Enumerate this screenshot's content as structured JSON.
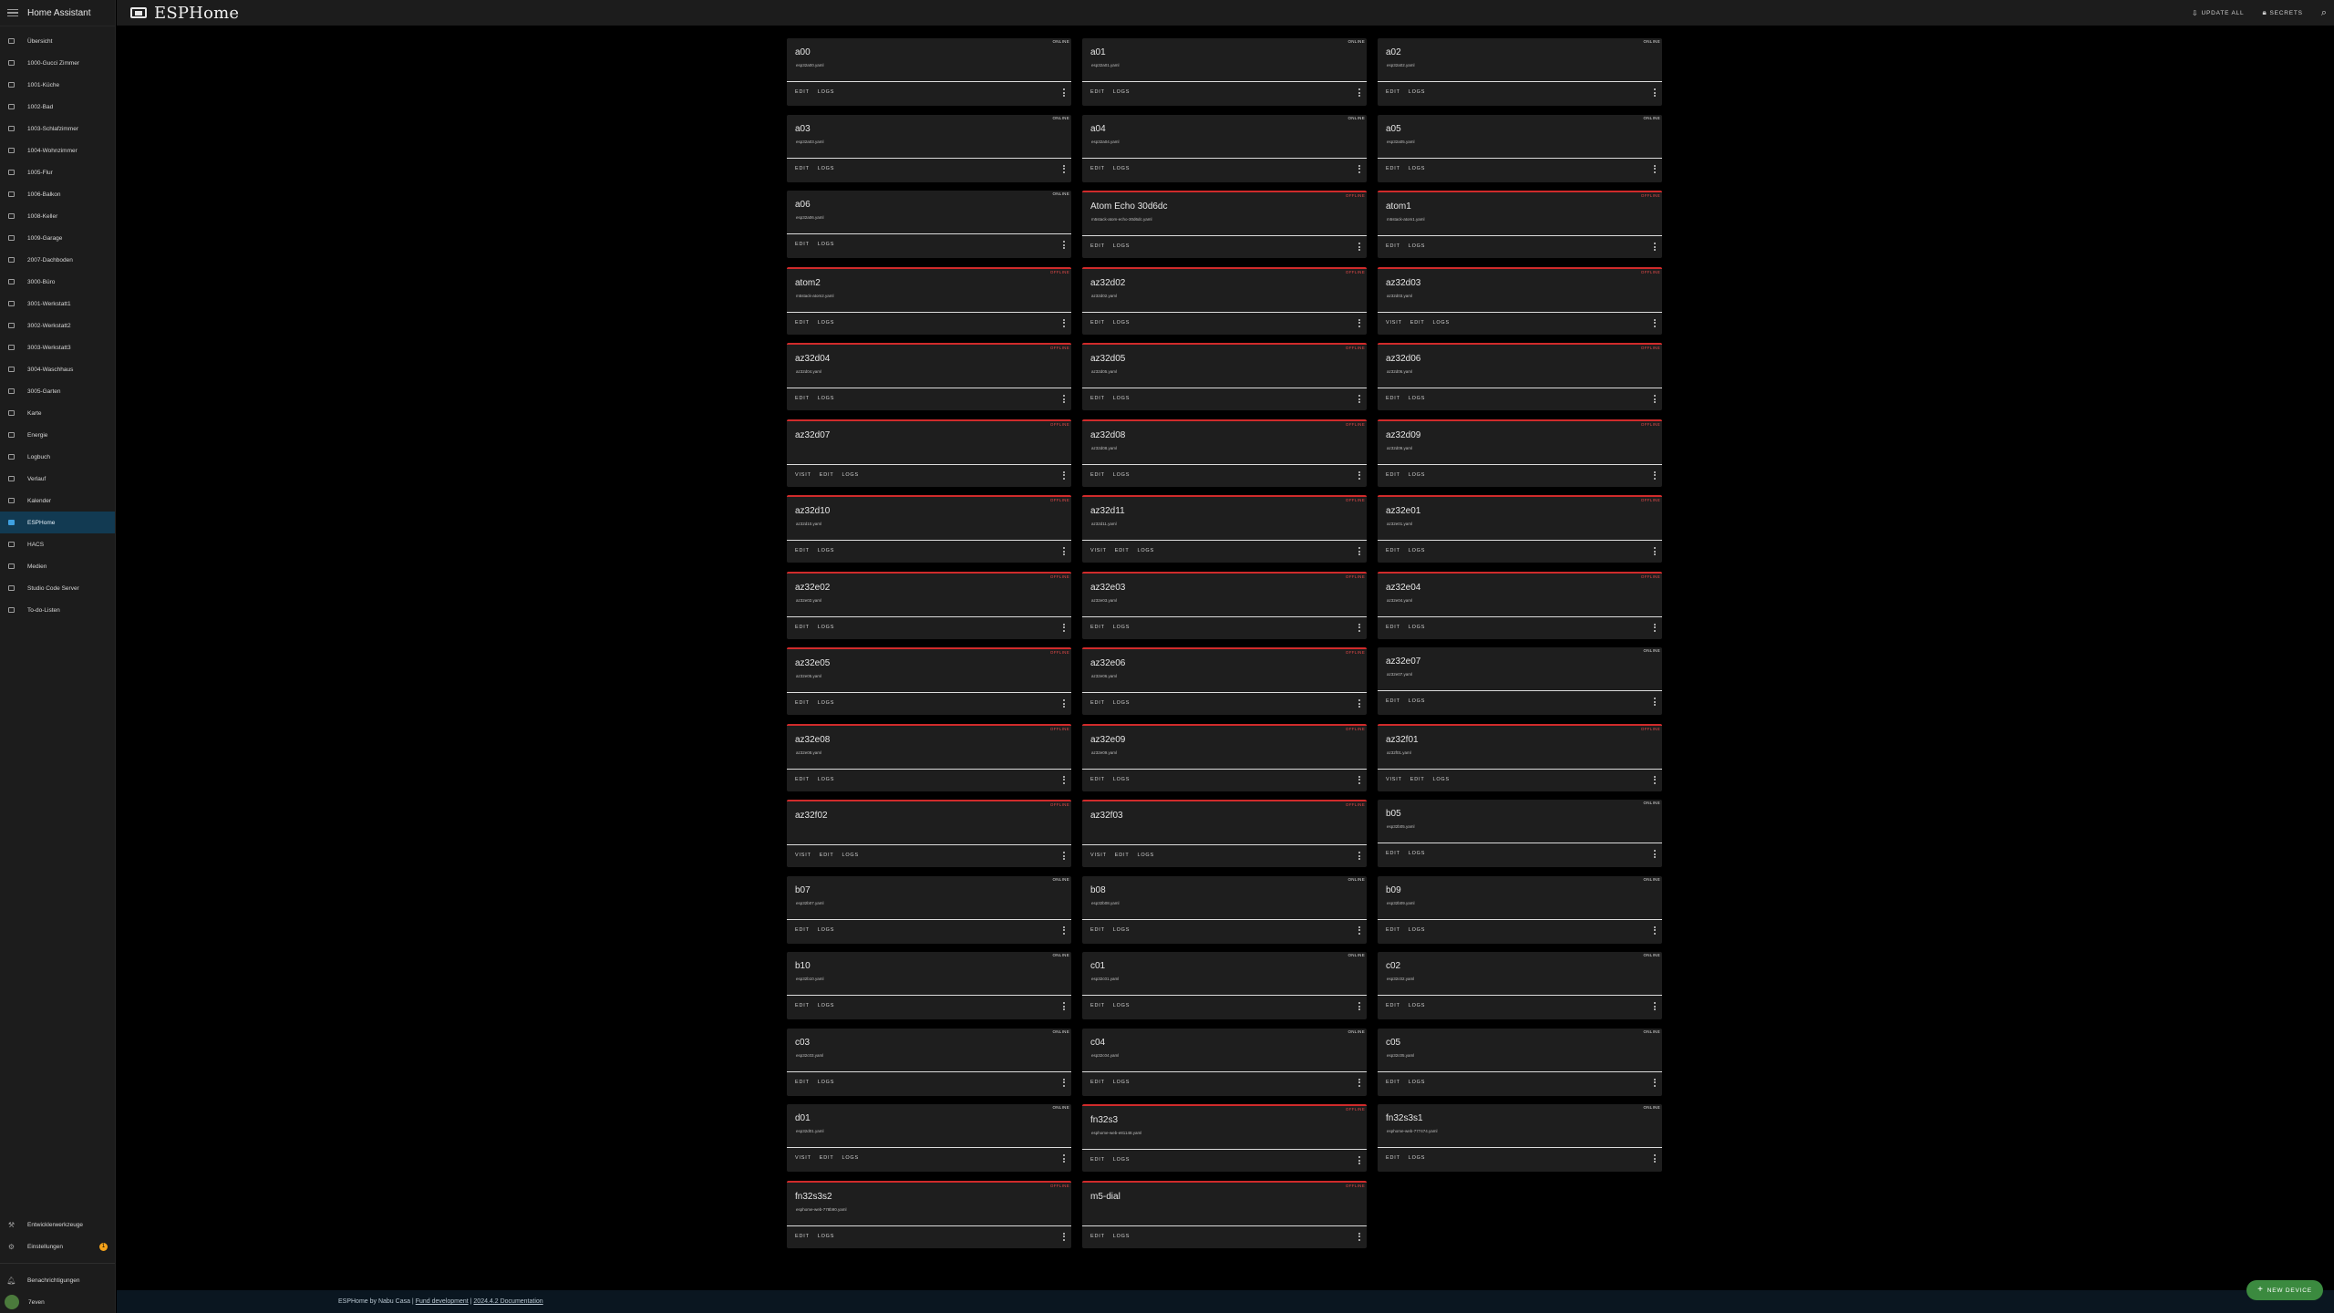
{
  "sidebar": {
    "title": "Home Assistant",
    "items": [
      {
        "label": "Übersicht",
        "icon": "dashboard-icon"
      },
      {
        "label": "1000-Gucci Zimmer",
        "icon": "sofa-icon"
      },
      {
        "label": "1001-Küche",
        "icon": "stove-icon"
      },
      {
        "label": "1002-Bad",
        "icon": "bath-icon"
      },
      {
        "label": "1003-Schlafzimmer",
        "icon": "bed-icon"
      },
      {
        "label": "1004-Wohnzimmer",
        "icon": "tv-icon"
      },
      {
        "label": "1005-Flur",
        "icon": "door-icon"
      },
      {
        "label": "1006-Balkon",
        "icon": "flower-icon"
      },
      {
        "label": "1008-Keller",
        "icon": "stairs-icon"
      },
      {
        "label": "1009-Garage",
        "icon": "garage-icon"
      },
      {
        "label": "2007-Dachboden",
        "icon": "monitor-icon"
      },
      {
        "label": "3000-Büro",
        "icon": "desk-icon"
      },
      {
        "label": "3001-Werkstatt1",
        "icon": "tools-icon"
      },
      {
        "label": "3002-Werkstatt2",
        "icon": "wrench-icon"
      },
      {
        "label": "3003-Werkstatt3",
        "icon": "hammer-icon"
      },
      {
        "label": "3004-Waschhaus",
        "icon": "washer-icon"
      },
      {
        "label": "3005-Garten",
        "icon": "tree-icon"
      },
      {
        "label": "Karte",
        "icon": "map-icon"
      },
      {
        "label": "Energie",
        "icon": "lightning-icon"
      },
      {
        "label": "Logbuch",
        "icon": "list-icon"
      },
      {
        "label": "Verlauf",
        "icon": "chart-icon"
      },
      {
        "label": "Kalender",
        "icon": "calendar-icon"
      },
      {
        "label": "ESPHome",
        "icon": "esphome-icon",
        "active": true
      },
      {
        "label": "HACS",
        "icon": "hacs-icon"
      },
      {
        "label": "Medien",
        "icon": "media-icon"
      },
      {
        "label": "Studio Code Server",
        "icon": "code-icon"
      },
      {
        "label": "To-do-Listen",
        "icon": "checklist-icon"
      }
    ],
    "bottom": {
      "dev_tools": "Entwicklerwerkzeuge",
      "settings": "Einstellungen",
      "settings_badge": "1",
      "notifications": "Benachrichtigungen",
      "user": "7even"
    }
  },
  "topbar": {
    "title": "ESPHome",
    "update_all": "UPDATE ALL",
    "secrets": "SECRETS",
    "search_icon": "search-icon"
  },
  "labels": {
    "online": "ONLINE",
    "offline": "OFFLINE",
    "edit": "EDIT",
    "logs": "LOGS",
    "visit": "VISIT"
  },
  "devices": [
    {
      "name": "a00",
      "file": "esp32a00.yaml",
      "online": true,
      "visit": false
    },
    {
      "name": "a01",
      "file": "esp32a01.yaml",
      "online": true,
      "visit": false
    },
    {
      "name": "a02",
      "file": "esp32a02.yaml",
      "online": true,
      "visit": false
    },
    {
      "name": "a03",
      "file": "esp32a03.yaml",
      "online": true,
      "visit": false
    },
    {
      "name": "a04",
      "file": "esp32a04.yaml",
      "online": true,
      "visit": false
    },
    {
      "name": "a05",
      "file": "esp32a05.yaml",
      "online": true,
      "visit": false
    },
    {
      "name": "a06",
      "file": "esp32a06.yaml",
      "online": true,
      "visit": false
    },
    {
      "name": "Atom Echo 30d6dc",
      "file": "m5stack-atom-echo-30d6dc.yaml",
      "online": false,
      "visit": false
    },
    {
      "name": "atom1",
      "file": "m5stack-atom1.yaml",
      "online": false,
      "visit": false
    },
    {
      "name": "atom2",
      "file": "m5stack-atom2.yaml",
      "online": false,
      "visit": false
    },
    {
      "name": "az32d02",
      "file": "az32d02.yaml",
      "online": false,
      "visit": false
    },
    {
      "name": "az32d03",
      "file": "az32d03.yaml",
      "online": false,
      "visit": true
    },
    {
      "name": "az32d04",
      "file": "az32d04.yaml",
      "online": false,
      "visit": false
    },
    {
      "name": "az32d05",
      "file": "az32d05.yaml",
      "online": false,
      "visit": false
    },
    {
      "name": "az32d06",
      "file": "az32d06.yaml",
      "online": false,
      "visit": false
    },
    {
      "name": "az32d07",
      "file": "",
      "online": false,
      "visit": true
    },
    {
      "name": "az32d08",
      "file": "az32d08.yaml",
      "online": false,
      "visit": false
    },
    {
      "name": "az32d09",
      "file": "az32d09.yaml",
      "online": false,
      "visit": false
    },
    {
      "name": "az32d10",
      "file": "az32d10.yaml",
      "online": false,
      "visit": false
    },
    {
      "name": "az32d11",
      "file": "az32d11.yaml",
      "online": false,
      "visit": true
    },
    {
      "name": "az32e01",
      "file": "az32e01.yaml",
      "online": false,
      "visit": false
    },
    {
      "name": "az32e02",
      "file": "az32e02.yaml",
      "online": false,
      "visit": false
    },
    {
      "name": "az32e03",
      "file": "az32e03.yaml",
      "online": false,
      "visit": false
    },
    {
      "name": "az32e04",
      "file": "az32e04.yaml",
      "online": false,
      "visit": false
    },
    {
      "name": "az32e05",
      "file": "az32e05.yaml",
      "online": false,
      "visit": false
    },
    {
      "name": "az32e06",
      "file": "az32e06.yaml",
      "online": false,
      "visit": false
    },
    {
      "name": "az32e07",
      "file": "az32e07.yaml",
      "online": true,
      "visit": false
    },
    {
      "name": "az32e08",
      "file": "az32e08.yaml",
      "online": false,
      "visit": false
    },
    {
      "name": "az32e09",
      "file": "az32e09.yaml",
      "online": false,
      "visit": false
    },
    {
      "name": "az32f01",
      "file": "az32f01.yaml",
      "online": false,
      "visit": true
    },
    {
      "name": "az32f02",
      "file": "",
      "online": false,
      "visit": true
    },
    {
      "name": "az32f03",
      "file": "",
      "online": false,
      "visit": true
    },
    {
      "name": "b05",
      "file": "esp32b05.yaml",
      "online": true,
      "visit": false
    },
    {
      "name": "b07",
      "file": "esp32b07.yaml",
      "online": true,
      "visit": false
    },
    {
      "name": "b08",
      "file": "esp32b08.yaml",
      "online": true,
      "visit": false
    },
    {
      "name": "b09",
      "file": "esp32b09.yaml",
      "online": true,
      "visit": false
    },
    {
      "name": "b10",
      "file": "esp32b10.yaml",
      "online": true,
      "visit": false
    },
    {
      "name": "c01",
      "file": "esp32c01.yaml",
      "online": true,
      "visit": false
    },
    {
      "name": "c02",
      "file": "esp32c02.yaml",
      "online": true,
      "visit": false
    },
    {
      "name": "c03",
      "file": "esp32c03.yaml",
      "online": true,
      "visit": false
    },
    {
      "name": "c04",
      "file": "esp32c04.yaml",
      "online": true,
      "visit": false
    },
    {
      "name": "c05",
      "file": "esp32c05.yaml",
      "online": true,
      "visit": false
    },
    {
      "name": "d01",
      "file": "esp32d01.yaml",
      "online": true,
      "visit": true
    },
    {
      "name": "fn32s3",
      "file": "esphome-web-e81148.yaml",
      "online": false,
      "visit": false
    },
    {
      "name": "fn32s3s1",
      "file": "esphome-web-777474.yaml",
      "online": true,
      "visit": false
    },
    {
      "name": "fn32s3s2",
      "file": "esphome-web-778b90.yaml",
      "online": false,
      "visit": false
    },
    {
      "name": "m5-dial",
      "file": "",
      "online": false,
      "visit": false
    }
  ],
  "footer": {
    "prefix": "ESPHome by Nabu Casa | ",
    "fund_link": "Fund development",
    "separator": " | ",
    "docs_link": "2024.4.2 Documentation"
  },
  "fab": {
    "label": "NEW DEVICE"
  },
  "colors": {
    "background": "#000000",
    "sidebar": "#1c1c1c",
    "card": "#1e1e1e",
    "offline_accent": "#d02b2b",
    "active_nav": "#123a52",
    "fab": "#3b8a3f",
    "badge": "#f4a21a"
  }
}
